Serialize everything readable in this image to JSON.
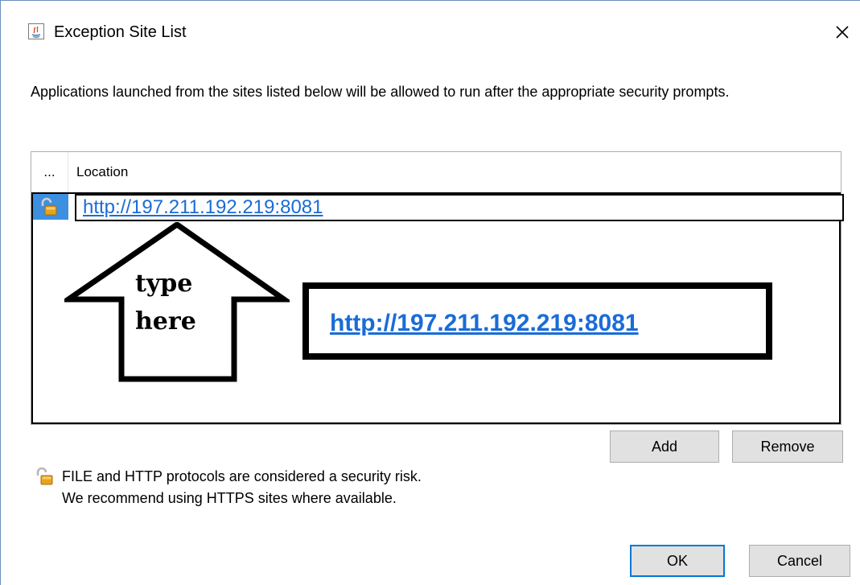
{
  "window": {
    "title": "Exception Site List",
    "close_label": "✕"
  },
  "description": "Applications launched from the sites listed below will be allowed to run after the appropriate security prompts.",
  "table": {
    "columns": [
      "...",
      "Location"
    ],
    "rows": [
      {
        "location": "http://197.211.192.219:8081"
      }
    ]
  },
  "annotation": {
    "arrow_line1": "type",
    "arrow_line2": "here",
    "url": "http://197.211.192.219:8081"
  },
  "buttons": {
    "add": "Add",
    "remove": "Remove",
    "ok": "OK",
    "cancel": "Cancel"
  },
  "warning": {
    "line1": "FILE and HTTP protocols are considered a security risk.",
    "line2": "We recommend using HTTPS sites where available."
  },
  "icons": {
    "title": "java-icon",
    "row": "unlocked-padlock-icon",
    "warning": "unlocked-padlock-icon",
    "close": "close-icon"
  },
  "colors": {
    "link": "#1a6cd6",
    "selection": "#3d8fe0",
    "padlock": "#e8a31c",
    "ok_border": "#0078d7"
  }
}
